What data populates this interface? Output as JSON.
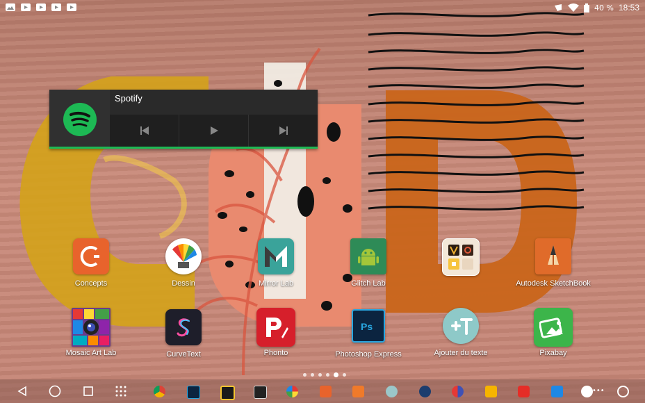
{
  "status_bar": {
    "left_icons": [
      "image-icon",
      "youtube-icon",
      "youtube-icon",
      "youtube-icon",
      "youtube-icon"
    ],
    "battery": "40 %",
    "time": "18:53"
  },
  "widget": {
    "title": "Spotify",
    "controls": [
      "previous-icon",
      "play-icon",
      "next-icon"
    ]
  },
  "apps": [
    {
      "label": "Concepts",
      "color": "#e8632c"
    },
    {
      "label": "Dessin",
      "color": "#ffffff"
    },
    {
      "label": "Mirror Lab",
      "color": "#3aa39a"
    },
    {
      "label": "Glitch Lab",
      "color": "#2e8b57"
    },
    {
      "label": "",
      "color": "#f3e7d8"
    },
    {
      "label": "Autodesk SketchBook",
      "color": "#e06b2a"
    },
    {
      "label": "Mosaic Art Lab",
      "color": "#6a3b8c"
    },
    {
      "label": "CurveText",
      "color": "#1e1e2a"
    },
    {
      "label": "Phonto",
      "color": "#d61f2b"
    },
    {
      "label": "Photoshop Express",
      "color": "#0b2440"
    },
    {
      "label": "Ajouter du texte",
      "color": "#8ec9c8"
    },
    {
      "label": "Pixabay",
      "color": "#3cb54a"
    }
  ],
  "page_indicator": {
    "count": 6,
    "active": 5
  },
  "dock": [
    "chrome-icon",
    "photoshop-mix-icon",
    "app-icon",
    "app-icon",
    "app-icon",
    "concepts-icon",
    "app-icon",
    "app-icon",
    "tasks-icon",
    "app-icon",
    "keep-icon",
    "youtube-icon",
    "app-icon",
    "mic-icon",
    "more-icon",
    "speed-icon"
  ]
}
